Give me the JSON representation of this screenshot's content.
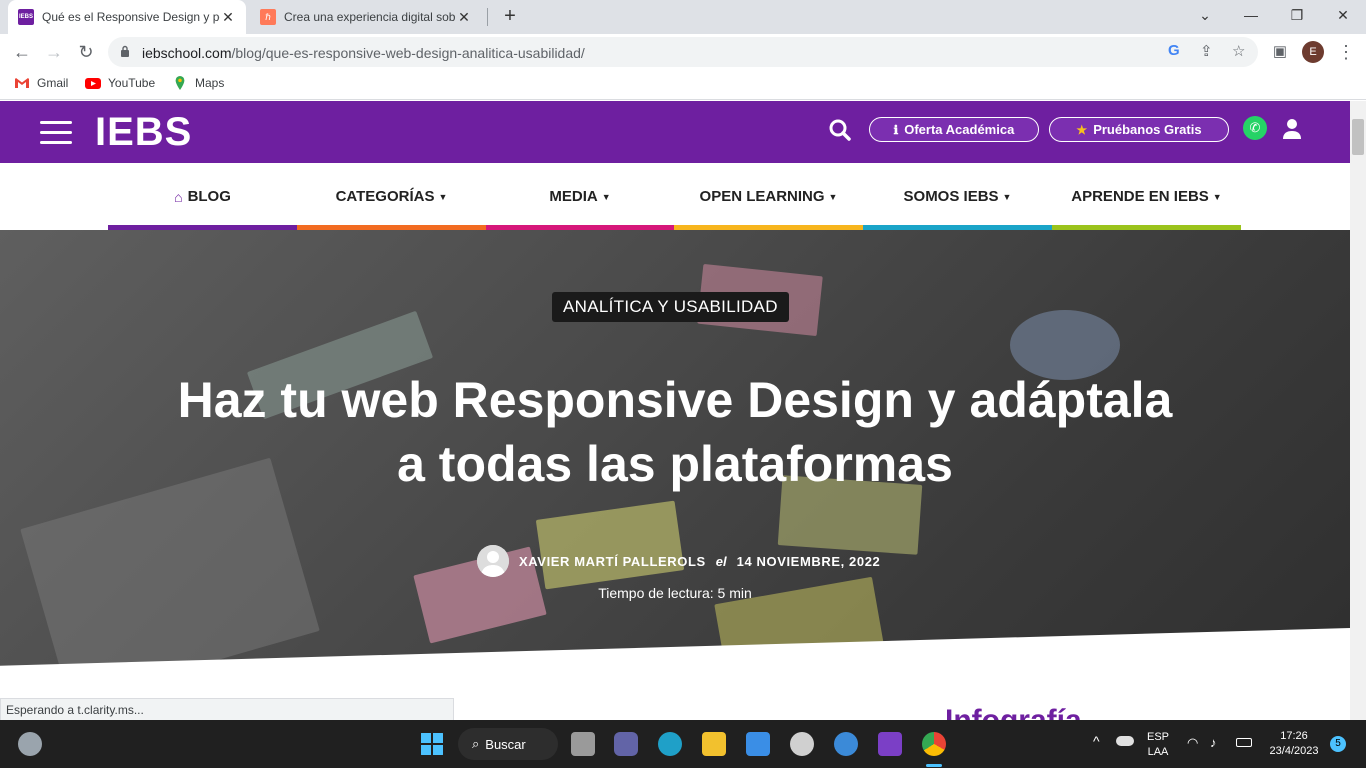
{
  "browser": {
    "tabs": [
      {
        "title": "Qué es el Responsive Design y por",
        "favicon": "iebs-favicon",
        "active": true
      },
      {
        "title": "Crea una experiencia digital sobre",
        "favicon": "hubspot-favicon",
        "active": false
      }
    ],
    "new_tab_label": "+",
    "url_domain": "iebschool.com",
    "url_path": "/blog/que-es-responsive-web-design-analitica-usabilidad/",
    "profile_initial": "E",
    "bookmarks": [
      {
        "label": "Gmail",
        "icon": "gmail-icon"
      },
      {
        "label": "YouTube",
        "icon": "youtube-icon"
      },
      {
        "label": "Maps",
        "icon": "maps-icon"
      }
    ],
    "status_text": "Esperando a t.clarity.ms..."
  },
  "site": {
    "logo_text": "IEBS",
    "oferta_label": "Oferta Académica",
    "pruebanos_label": "Pruébanos Gratis",
    "nav": [
      {
        "label": "BLOG",
        "has_icon": true,
        "color": "#6e1fa0"
      },
      {
        "label": "CATEGORÍAS",
        "has_caret": true,
        "color": "#f26b21"
      },
      {
        "label": "MEDIA",
        "has_caret": true,
        "color": "#d6177a"
      },
      {
        "label": "OPEN LEARNING",
        "has_caret": true,
        "color": "#f7b51d"
      },
      {
        "label": "SOMOS IEBS",
        "has_caret": true,
        "color": "#1aa4c8"
      },
      {
        "label": "APRENDE EN IEBS",
        "has_caret": true,
        "color": "#9bc31c"
      }
    ],
    "brand_color": "#6e1fa0"
  },
  "article": {
    "category": "ANALÍTICA Y USABILIDAD",
    "title_line1": "Haz tu web Responsive Design y adáptala",
    "title_line2": "a todas las plataformas",
    "author": "XAVIER MARTÍ PALLEROLS",
    "el": "el",
    "date": "14 NOVIEMBRE, 2022",
    "reading_time": "Tiempo de lectura: 5 min",
    "next_heading": "Infografía"
  },
  "taskbar": {
    "search_label": "Buscar",
    "lang_line1": "ESP",
    "lang_line2": "LAA",
    "time": "17:26",
    "date": "23/4/2023",
    "notifications": "5"
  }
}
